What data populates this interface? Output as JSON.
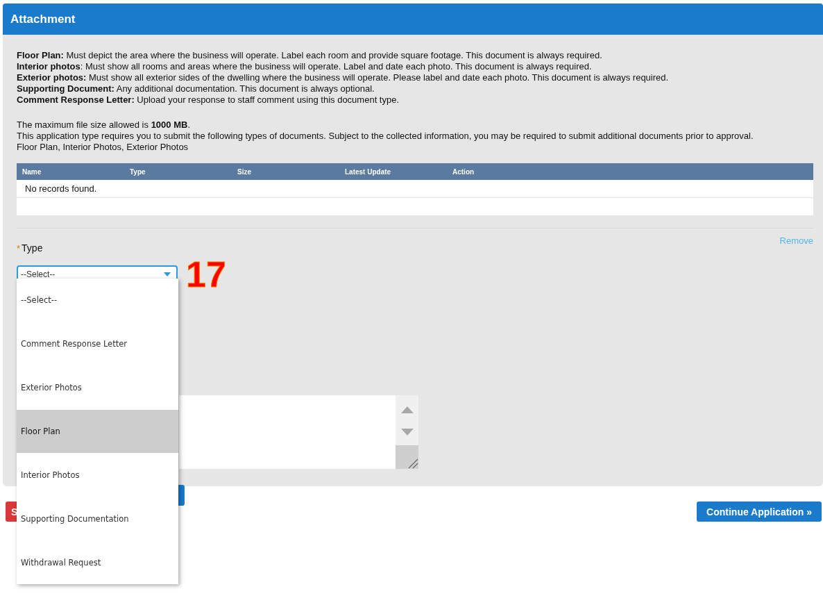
{
  "panel": {
    "title": "Attachment",
    "descriptions": [
      "**Floor Plan:** Must depict the area where the business will operate. Label each room and provide square footage. This document is always required.",
      "**Interior photos**: Must show all rooms and areas where the business will operate. Label and date each photo. This document is always required.",
      "**Exterior photos:** Must show all exterior sides of the dwelling where the business will operate. Please label and date each photo. This document is always required.",
      "**Supporting Document:** Any additional documentation. This document is always optional.",
      "**Comment Response Letter:** Upload your response to staff comment using this document type."
    ],
    "max_size": "The maximum file size allowed is **1000 MB**.",
    "requirement": "This application type requires you to submit the following types of documents. Subject to the collected information, you may be required to submit additional documents prior to approval.",
    "required_types": "Floor Plan, Interior Photos, Exterior Photos",
    "table": {
      "columns": [
        "Name",
        "Type",
        "Size",
        "Latest Update",
        "Action"
      ],
      "empty_message": "No records found."
    },
    "type_field": {
      "required_mark": "*",
      "label": "Type",
      "value": "--Select--",
      "options": [
        {
          "label": "--Select--",
          "highlighted": false
        },
        {
          "label": "Comment Response Letter",
          "highlighted": false
        },
        {
          "label": "Exterior Photos",
          "highlighted": false
        },
        {
          "label": "Floor Plan",
          "highlighted": true
        },
        {
          "label": "Interior Photos",
          "highlighted": false
        },
        {
          "label": "Supporting Documentation",
          "highlighted": false
        },
        {
          "label": "Withdrawal Request",
          "highlighted": false
        }
      ]
    },
    "remove_link": "Remove"
  },
  "annotation": "17",
  "buttons": [
    {
      "label": "S",
      "kind": "danger"
    },
    {
      "label": "Continue Application »",
      "kind": "primary"
    }
  ]
}
